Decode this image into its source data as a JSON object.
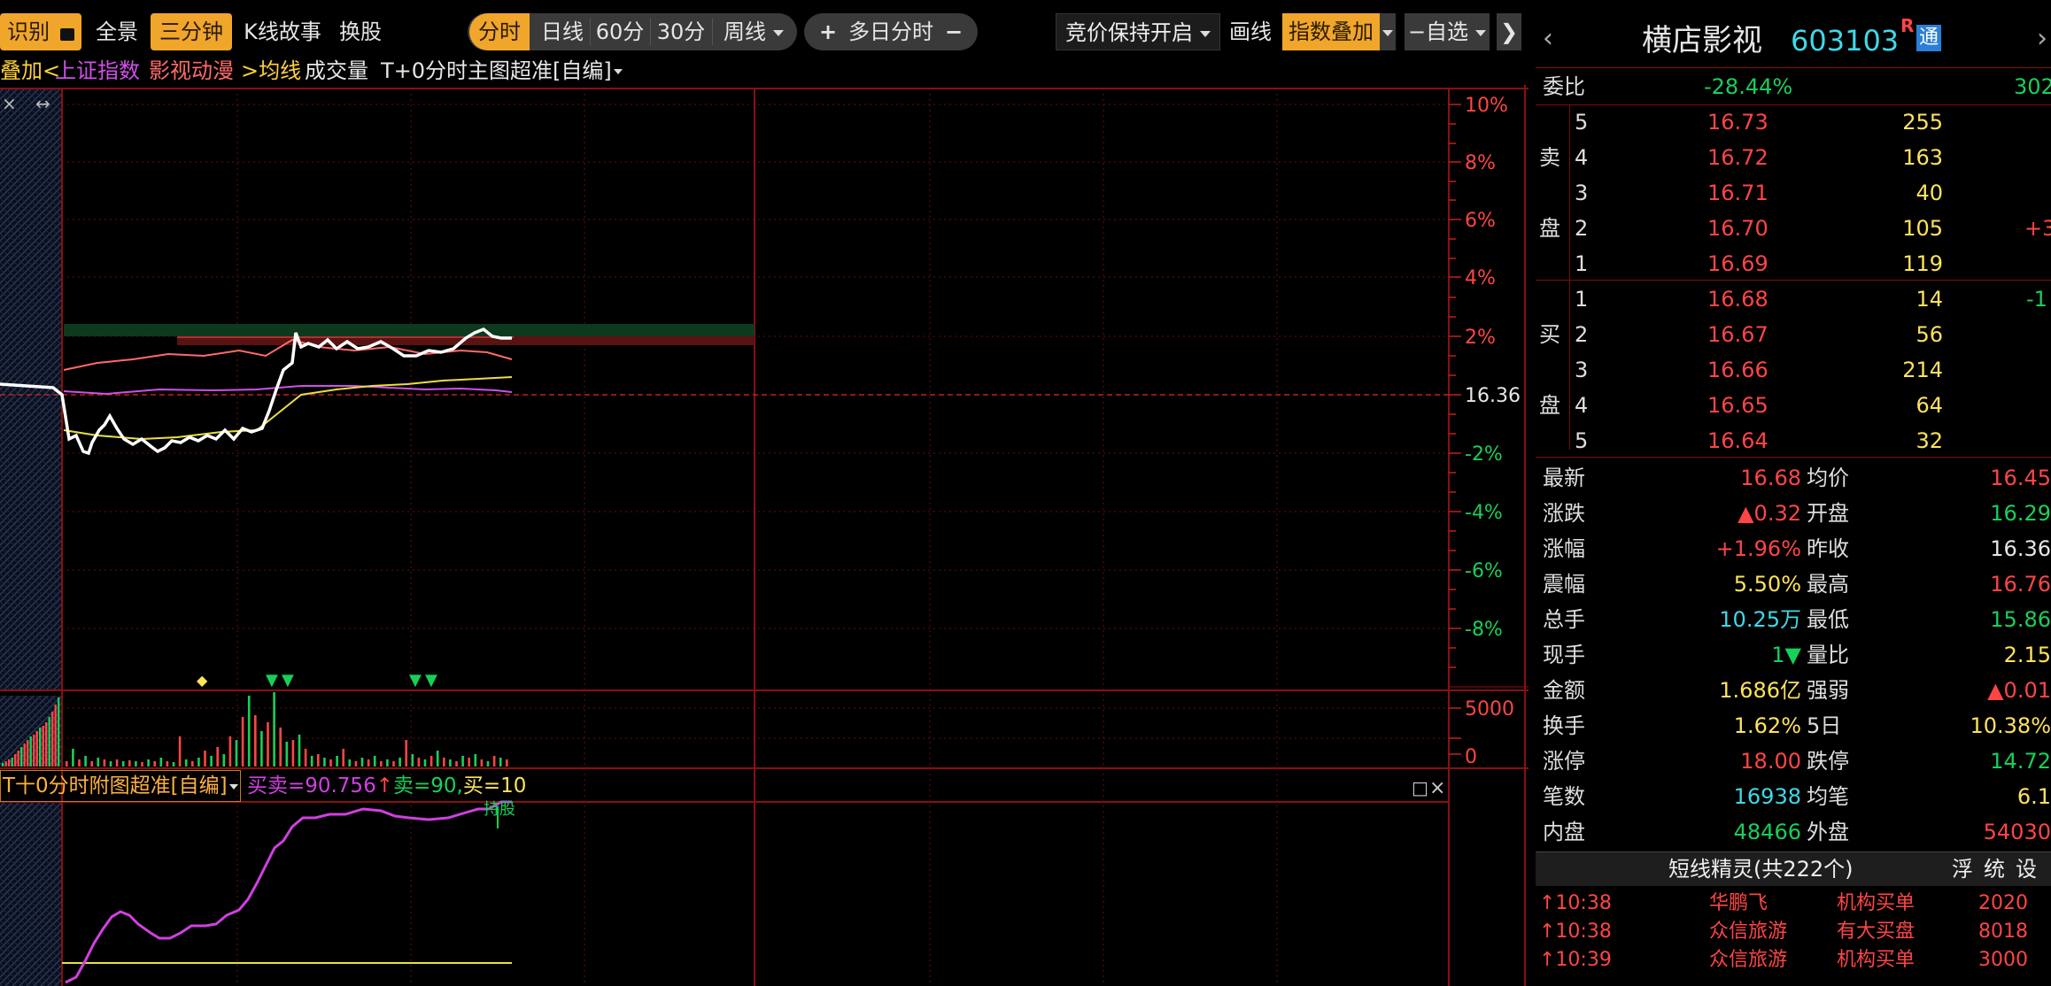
{
  "toolbar": {
    "left_items": [
      {
        "label": "识别",
        "highlight": true,
        "lock": true
      },
      {
        "label": "全景",
        "highlight": false
      },
      {
        "label": "三分钟",
        "highlight": true
      },
      {
        "label": "K线故事",
        "highlight": false
      },
      {
        "label": "换股",
        "highlight": false
      }
    ],
    "periods": [
      "分时",
      "日线",
      "60分",
      "30分",
      "周线"
    ],
    "period_active": "分时",
    "multiday": {
      "plus": "+",
      "label": "多日分时",
      "minus": "−"
    },
    "auction_select": "竞价保持开启",
    "draw_label": "画线",
    "index_overlay": "指数叠加",
    "watchlist": "自选",
    "collapse_icon": "collapse-right"
  },
  "overlay": {
    "prefix": "叠加<",
    "index1": "上证指数",
    "index2": "影视动漫",
    "avg": ">均线",
    "volume": "成交量",
    "main_indicator": "T+0分时主图超准[自编]"
  },
  "axis": {
    "right_pct": [
      "10%",
      "8%",
      "6%",
      "4%",
      "2%",
      "16.36",
      "-2%",
      "-4%",
      "-6%",
      "-8%"
    ],
    "vol_ticks": [
      "5000",
      "0"
    ]
  },
  "sub_indicator": {
    "name": "T十0分时附图超准[自编]",
    "buysell": "买卖=90.756",
    "sell": "卖=90,",
    "buy": "买=10",
    "signal": "持股"
  },
  "chart_marks": {
    "left_icons": [
      "×",
      "↔"
    ],
    "window_icons": [
      "□",
      "×"
    ]
  },
  "stock": {
    "name": "横店影视",
    "code": "603103",
    "badge_r": "R",
    "badge_tong": "通",
    "webi_label": "委比",
    "webi": "-28.44%",
    "weicha": "302",
    "sell_side_label": [
      "卖",
      "盘"
    ],
    "buy_side_label": [
      "买",
      "盘"
    ],
    "asks": [
      {
        "lvl": "5",
        "price": "16.73",
        "vol": "255",
        "chg": ""
      },
      {
        "lvl": "4",
        "price": "16.72",
        "vol": "163",
        "chg": ""
      },
      {
        "lvl": "3",
        "price": "16.71",
        "vol": "40",
        "chg": ""
      },
      {
        "lvl": "2",
        "price": "16.70",
        "vol": "105",
        "chg": "+3"
      },
      {
        "lvl": "1",
        "price": "16.69",
        "vol": "119",
        "chg": ""
      }
    ],
    "bids": [
      {
        "lvl": "1",
        "price": "16.68",
        "vol": "14",
        "chg": "-1"
      },
      {
        "lvl": "2",
        "price": "16.67",
        "vol": "56",
        "chg": ""
      },
      {
        "lvl": "3",
        "price": "16.66",
        "vol": "214",
        "chg": ""
      },
      {
        "lvl": "4",
        "price": "16.65",
        "vol": "64",
        "chg": ""
      },
      {
        "lvl": "5",
        "price": "16.64",
        "vol": "32",
        "chg": ""
      }
    ],
    "quote": [
      {
        "l": "最新",
        "v": "16.68",
        "vc": "red",
        "l2": "均价",
        "v2": "16.45",
        "v2c": "red"
      },
      {
        "l": "涨跌",
        "v": "▲0.32",
        "vc": "red",
        "l2": "开盘",
        "v2": "16.29",
        "v2c": "grn"
      },
      {
        "l": "涨幅",
        "v": "+1.96%",
        "vc": "red",
        "l2": "昨收",
        "v2": "16.36",
        "v2c": "wht"
      },
      {
        "l": "震幅",
        "v": "5.50%",
        "vc": "yel",
        "l2": "最高",
        "v2": "16.76",
        "v2c": "red"
      },
      {
        "l": "总手",
        "v": "10.25万",
        "vc": "cyn",
        "l2": "最低",
        "v2": "15.86",
        "v2c": "grn"
      },
      {
        "l": "现手",
        "v": "1▼",
        "vc": "grn",
        "l2": "量比",
        "v2": "2.15",
        "v2c": "yel"
      },
      {
        "l": "金额",
        "v": "1.686亿",
        "vc": "yel",
        "l2": "强弱",
        "v2": "▲0.01",
        "v2c": "red"
      },
      {
        "l": "换手",
        "v": "1.62%",
        "vc": "yel",
        "l2": "5日",
        "v2": "10.38%",
        "v2c": "yel"
      },
      {
        "l": "涨停",
        "v": "18.00",
        "vc": "red",
        "l2": "跌停",
        "v2": "14.72",
        "v2c": "grn"
      },
      {
        "l": "笔数",
        "v": "16938",
        "vc": "cyn",
        "l2": "均笔",
        "v2": "6.1",
        "v2c": "yel"
      },
      {
        "l": "内盘",
        "v": "48466",
        "vc": "grn",
        "l2": "外盘",
        "v2": "54030",
        "v2c": "red"
      }
    ]
  },
  "sprite": {
    "title": "短线精灵(共222个)",
    "btns": [
      "浮",
      "统",
      "设"
    ],
    "rows": [
      {
        "t": "↑10:38",
        "name": "华鹏飞",
        "ev": "机构买单",
        "v": "2020"
      },
      {
        "t": "↑10:38",
        "name": "众信旅游",
        "ev": "有大买盘",
        "v": "8018"
      },
      {
        "t": "↑10:39",
        "name": "众信旅游",
        "ev": "机构买单",
        "v": "3000"
      }
    ]
  },
  "colors": {
    "accent": "#f0a62b",
    "up": "#ff4545",
    "down": "#17d05a",
    "grid": "#7a0f0f"
  }
}
